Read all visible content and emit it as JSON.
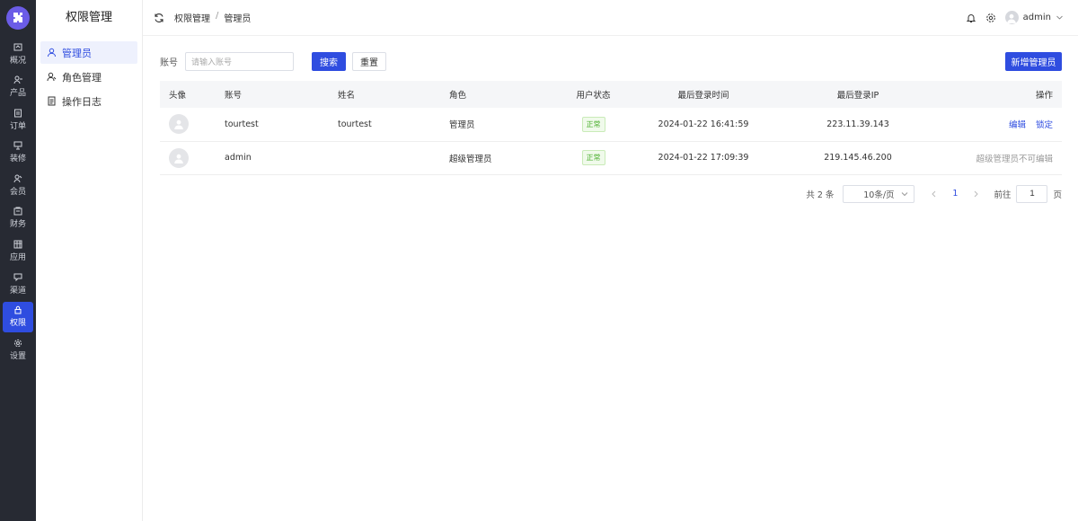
{
  "nav": {
    "logo_icon": "puzzle-icon",
    "items": [
      {
        "label": "概况",
        "icon": "dashboard-icon"
      },
      {
        "label": "产品",
        "icon": "product-icon"
      },
      {
        "label": "订单",
        "icon": "order-icon"
      },
      {
        "label": "装修",
        "icon": "decoration-icon"
      },
      {
        "label": "会员",
        "icon": "member-icon"
      },
      {
        "label": "财务",
        "icon": "finance-icon"
      },
      {
        "label": "应用",
        "icon": "app-icon"
      },
      {
        "label": "渠道",
        "icon": "channel-icon"
      },
      {
        "label": "权限",
        "icon": "lock-icon",
        "active": true
      },
      {
        "label": "设置",
        "icon": "settings-icon"
      }
    ]
  },
  "sidebar": {
    "title": "权限管理",
    "items": [
      {
        "label": "管理员",
        "icon": "user-icon",
        "active": true
      },
      {
        "label": "角色管理",
        "icon": "role-icon"
      },
      {
        "label": "操作日志",
        "icon": "log-icon"
      }
    ]
  },
  "header": {
    "breadcrumb": [
      "权限管理",
      "管理员"
    ],
    "breadcrumb_sep": "/",
    "username": "admin"
  },
  "filter": {
    "label": "账号",
    "placeholder": "请输入账号",
    "search_label": "搜索",
    "reset_label": "重置",
    "add_label": "新增管理员"
  },
  "table": {
    "columns": [
      "头像",
      "账号",
      "姓名",
      "角色",
      "用户状态",
      "最后登录时间",
      "最后登录IP",
      "操作"
    ],
    "rows": [
      {
        "account": "tourtest",
        "name": "tourtest",
        "role": "管理员",
        "status": "正常",
        "last_login_time": "2024-01-22 16:41:59",
        "last_login_ip": "223.11.39.143",
        "actions": [
          "编辑",
          "锁定"
        ]
      },
      {
        "account": "admin",
        "name": "",
        "role": "超级管理员",
        "status": "正常",
        "last_login_time": "2024-01-22 17:09:39",
        "last_login_ip": "219.145.46.200",
        "actions_note": "超级管理员不可编辑"
      }
    ]
  },
  "pagination": {
    "total": "共 2 条",
    "page_size": "10条/页",
    "current_page": "1",
    "goto_label": "前往",
    "goto_value": "1",
    "unit": "页"
  },
  "colors": {
    "primary": "#2f4de0",
    "nav_bg": "#272a33",
    "status_green": "#4caf2f"
  }
}
